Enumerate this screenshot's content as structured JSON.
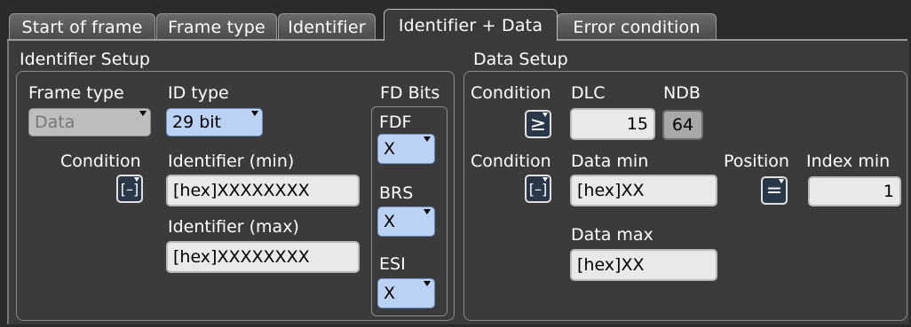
{
  "tabs": [
    {
      "label": "Start of frame",
      "active": false
    },
    {
      "label": "Frame type",
      "active": false
    },
    {
      "label": "Identifier",
      "active": false
    },
    {
      "label": "Identifier + Data",
      "active": true
    },
    {
      "label": "Error condition",
      "active": false
    }
  ],
  "identifier_setup": {
    "title": "Identifier Setup",
    "frame_type": {
      "label": "Frame type",
      "value": "Data",
      "enabled": false
    },
    "id_type": {
      "label": "ID type",
      "value": "29 bit"
    },
    "condition": {
      "label": "Condition",
      "operator": "[–]"
    },
    "identifier_min": {
      "label": "Identifier (min)",
      "value": "[hex]XXXXXXXX"
    },
    "identifier_max": {
      "label": "Identifier (max)",
      "value": "[hex]XXXXXXXX"
    },
    "fd_bits": {
      "title": "FD Bits",
      "fdf": {
        "label": "FDF",
        "value": "X"
      },
      "brs": {
        "label": "BRS",
        "value": "X"
      },
      "esi": {
        "label": "ESI",
        "value": "X"
      }
    }
  },
  "data_setup": {
    "title": "Data Setup",
    "dlc_condition": {
      "label": "Condition",
      "operator": "≥"
    },
    "dlc": {
      "label": "DLC",
      "value": "15"
    },
    "ndb": {
      "label": "NDB",
      "value": "64"
    },
    "data_condition": {
      "label": "Condition",
      "operator": "[–]"
    },
    "data_min": {
      "label": "Data min",
      "value": "[hex]XX"
    },
    "data_max": {
      "label": "Data max",
      "value": "[hex]XX"
    },
    "position": {
      "label": "Position",
      "operator": "="
    },
    "index_min": {
      "label": "Index min",
      "value": "1"
    }
  },
  "colors": {
    "dropdown_bg": "#bcd2f4",
    "field_bg": "#e9e9e9",
    "panel_bg": "#3b3b3b",
    "operator_bg": "#283848"
  },
  "icons": {
    "dropdown": "chevron-down-icon",
    "range_operator": "range-bracket-icon",
    "gte_operator": "greater-equal-icon",
    "equal_operator": "equal-icon"
  }
}
